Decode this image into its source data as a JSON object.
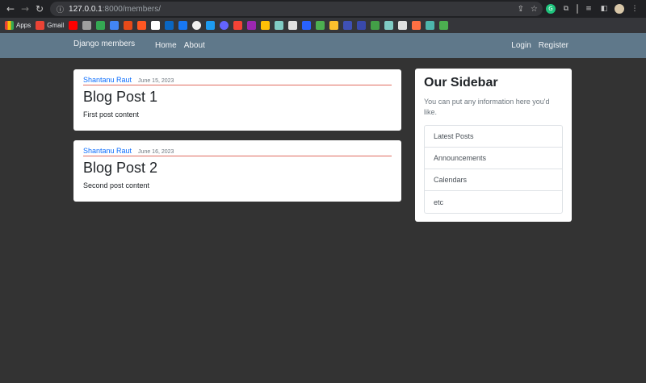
{
  "browser": {
    "url_host": "127.0.0.1",
    "url_rest": ":8000/members/",
    "bookmarks": [
      "Apps",
      "Gmail"
    ]
  },
  "navbar": {
    "brand": "Django members",
    "left_links": [
      "Home",
      "About"
    ],
    "right_links": [
      "Login",
      "Register"
    ],
    "color": "#5f788a"
  },
  "posts": [
    {
      "author": "Shantanu Raut",
      "date": "June 15, 2023",
      "title": "Blog Post 1",
      "content": "First post content"
    },
    {
      "author": "Shantanu Raut",
      "date": "June 16, 2023",
      "title": "Blog Post 2",
      "content": "Second post content"
    }
  ],
  "sidebar": {
    "title": "Our Sidebar",
    "text": "You can put any information here you'd like.",
    "items": [
      "Latest Posts",
      "Announcements",
      "Calendars",
      "etc"
    ]
  },
  "colors": {
    "background": "#333333",
    "link": "#0d6efd",
    "divider": "#e06b5f"
  }
}
